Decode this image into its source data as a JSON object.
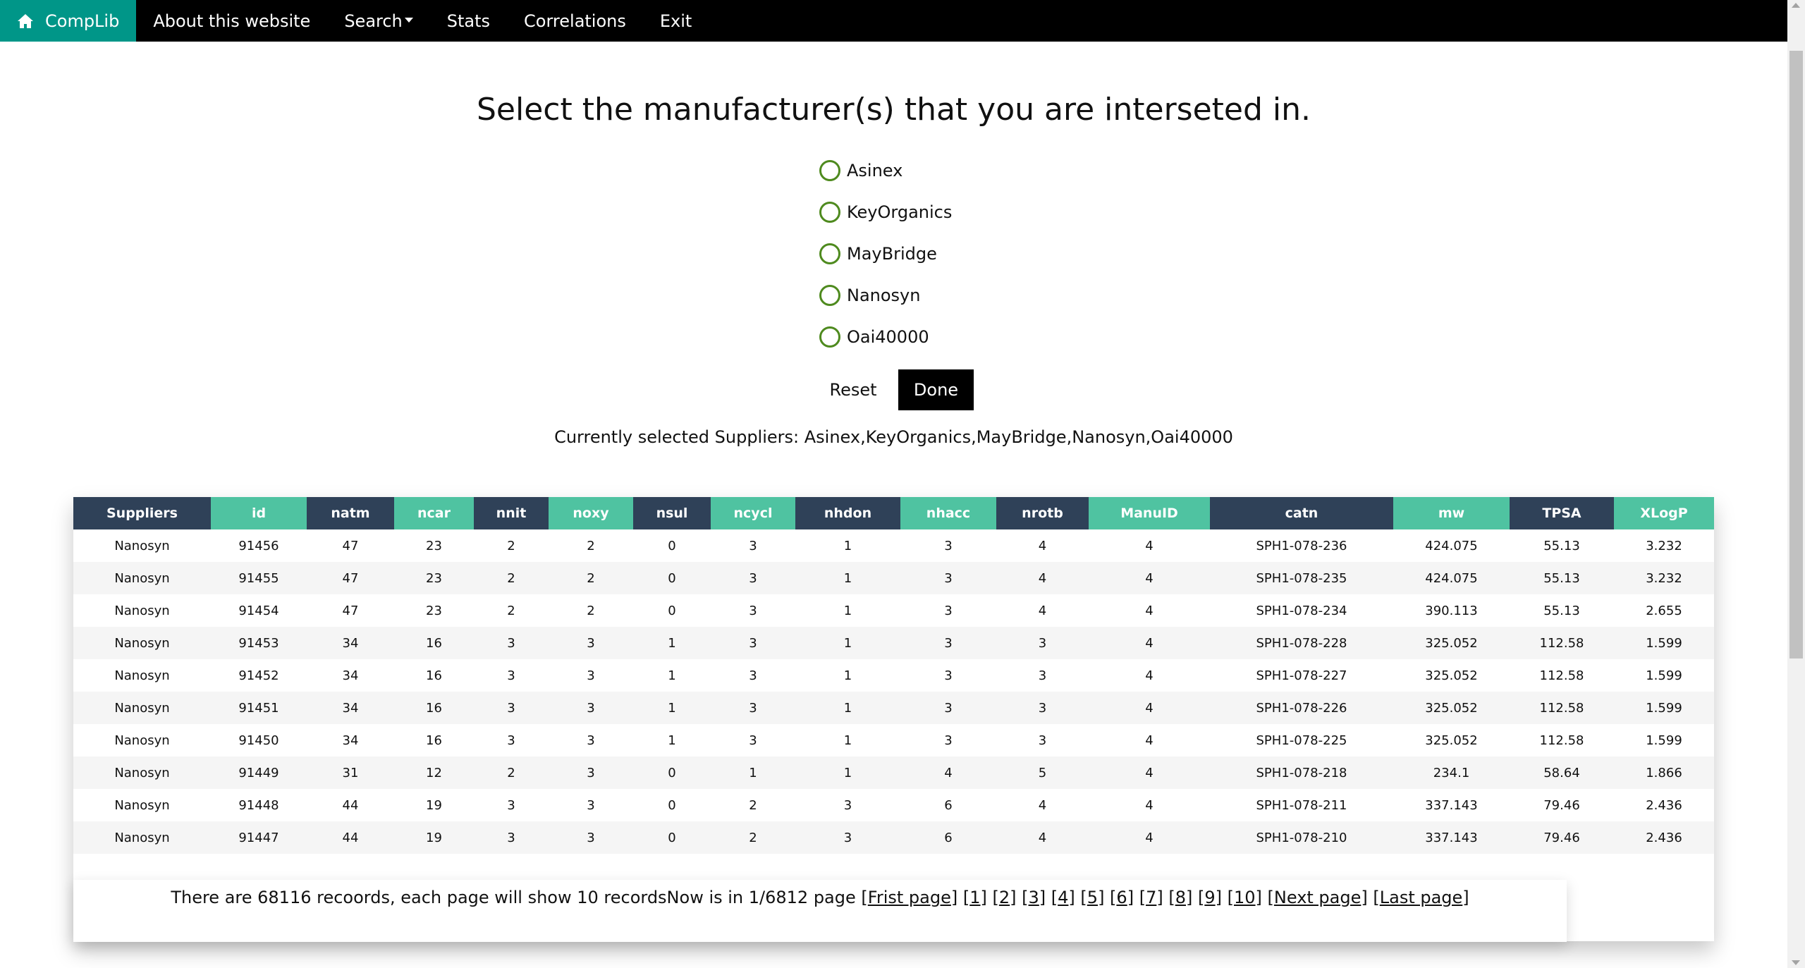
{
  "nav": {
    "brand": "CompLib",
    "items": [
      "About this website",
      "Search",
      "Stats",
      "Correlations",
      "Exit"
    ]
  },
  "main": {
    "title": "Select the manufacturer(s) that you are interseted in.",
    "options": [
      "Asinex",
      "KeyOrganics",
      "MayBridge",
      "Nanosyn",
      "Oai40000"
    ],
    "reset_label": "Reset",
    "done_label": "Done",
    "selected_text": "Currently selected Suppliers: Asinex,KeyOrganics,MayBridge,Nanosyn,Oai40000"
  },
  "table": {
    "columns": [
      "Suppliers",
      "id",
      "natm",
      "ncar",
      "nnit",
      "noxy",
      "nsul",
      "ncycl",
      "nhdon",
      "nhacc",
      "nrotb",
      "ManuID",
      "catn",
      "mw",
      "TPSA",
      "XLogP"
    ],
    "header_colors": [
      "#2f4158",
      "#4fc3a1"
    ],
    "rows": [
      [
        "Nanosyn",
        "91456",
        "47",
        "23",
        "2",
        "2",
        "0",
        "3",
        "1",
        "3",
        "4",
        "4",
        "SPH1-078-236",
        "424.075",
        "55.13",
        "3.232"
      ],
      [
        "Nanosyn",
        "91455",
        "47",
        "23",
        "2",
        "2",
        "0",
        "3",
        "1",
        "3",
        "4",
        "4",
        "SPH1-078-235",
        "424.075",
        "55.13",
        "3.232"
      ],
      [
        "Nanosyn",
        "91454",
        "47",
        "23",
        "2",
        "2",
        "0",
        "3",
        "1",
        "3",
        "4",
        "4",
        "SPH1-078-234",
        "390.113",
        "55.13",
        "2.655"
      ],
      [
        "Nanosyn",
        "91453",
        "34",
        "16",
        "3",
        "3",
        "1",
        "3",
        "1",
        "3",
        "3",
        "4",
        "SPH1-078-228",
        "325.052",
        "112.58",
        "1.599"
      ],
      [
        "Nanosyn",
        "91452",
        "34",
        "16",
        "3",
        "3",
        "1",
        "3",
        "1",
        "3",
        "3",
        "4",
        "SPH1-078-227",
        "325.052",
        "112.58",
        "1.599"
      ],
      [
        "Nanosyn",
        "91451",
        "34",
        "16",
        "3",
        "3",
        "1",
        "3",
        "1",
        "3",
        "3",
        "4",
        "SPH1-078-226",
        "325.052",
        "112.58",
        "1.599"
      ],
      [
        "Nanosyn",
        "91450",
        "34",
        "16",
        "3",
        "3",
        "1",
        "3",
        "1",
        "3",
        "3",
        "4",
        "SPH1-078-225",
        "325.052",
        "112.58",
        "1.599"
      ],
      [
        "Nanosyn",
        "91449",
        "31",
        "12",
        "2",
        "3",
        "0",
        "1",
        "1",
        "4",
        "5",
        "4",
        "SPH1-078-218",
        "234.1",
        "58.64",
        "1.866"
      ],
      [
        "Nanosyn",
        "91448",
        "44",
        "19",
        "3",
        "3",
        "0",
        "2",
        "3",
        "6",
        "4",
        "4",
        "SPH1-078-211",
        "337.143",
        "79.46",
        "2.436"
      ],
      [
        "Nanosyn",
        "91447",
        "44",
        "19",
        "3",
        "3",
        "0",
        "2",
        "3",
        "6",
        "4",
        "4",
        "SPH1-078-210",
        "337.143",
        "79.46",
        "2.436"
      ]
    ]
  },
  "pagination": {
    "info": "There are 68116 recoords, each page will show 10 recordsNow is in 1/6812 page ",
    "first": "Frist page",
    "pages": [
      "1",
      "2",
      "3",
      "4",
      "5",
      "6",
      "7",
      "8",
      "9",
      "10"
    ],
    "next": "Next page",
    "last": "Last page"
  }
}
